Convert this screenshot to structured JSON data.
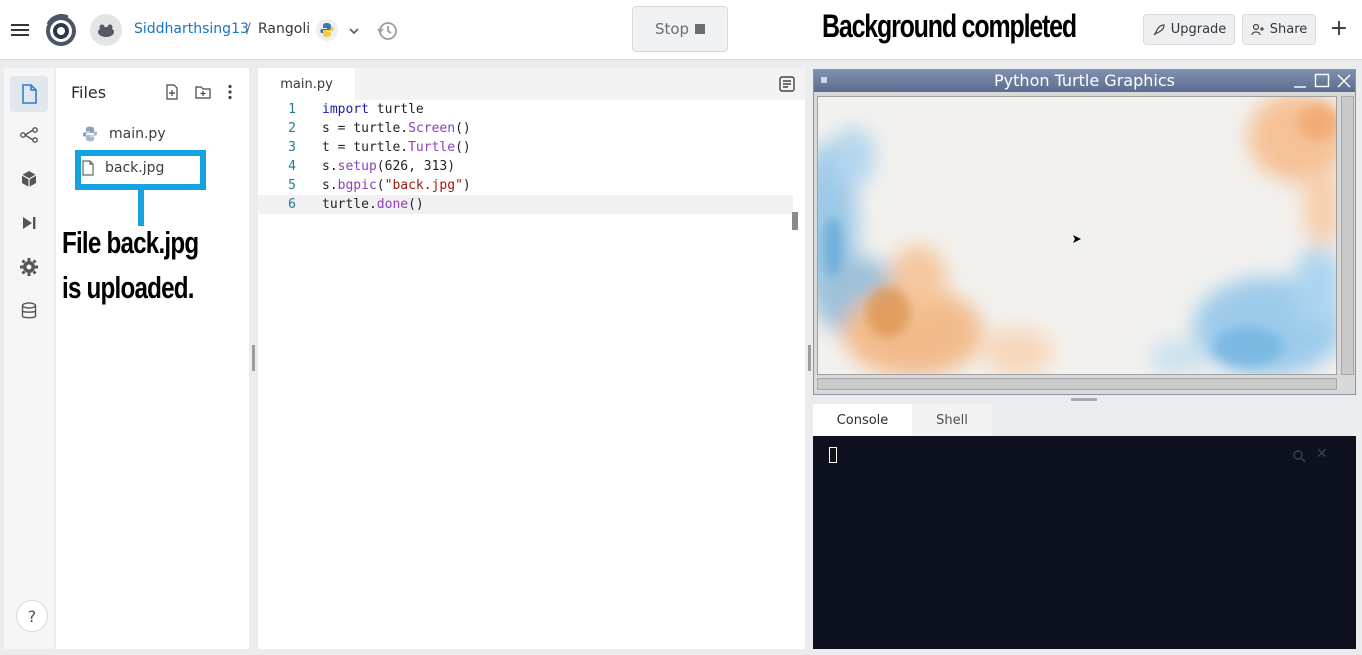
{
  "header": {
    "username": "Siddharthsing13",
    "separator": "/",
    "project_name": "Rangoli",
    "stop_label": "Stop",
    "upgrade_label": "Upgrade",
    "share_label": "Share",
    "plus_label": "+"
  },
  "annotations": {
    "top": "Background completed",
    "file_line1": "File back.jpg",
    "file_line2": "is uploaded."
  },
  "files_panel": {
    "title": "Files",
    "files": [
      {
        "name": "main.py",
        "icon": "python-icon"
      },
      {
        "name": "back.jpg",
        "icon": "file-icon"
      }
    ]
  },
  "editor": {
    "tab_label": "main.py",
    "lines": [
      {
        "num": "1",
        "text": "import turtle"
      },
      {
        "num": "2",
        "text": "s = turtle.Screen()"
      },
      {
        "num": "3",
        "text": "t = turtle.Turtle()"
      },
      {
        "num": "4",
        "text": "s.setup(626, 313)"
      },
      {
        "num": "5",
        "text": "s.bgpic(\"back.jpg\")"
      },
      {
        "num": "6",
        "text": "turtle.done()"
      }
    ]
  },
  "turtle_window": {
    "title": "Python Turtle Graphics"
  },
  "console": {
    "tab_console": "Console",
    "tab_shell": "Shell"
  },
  "sidebar": {
    "help_label": "?"
  },
  "colors": {
    "accent_blue": "#1a73c8",
    "highlight_cyan": "#13a3e0",
    "console_bg": "#0e1220"
  }
}
